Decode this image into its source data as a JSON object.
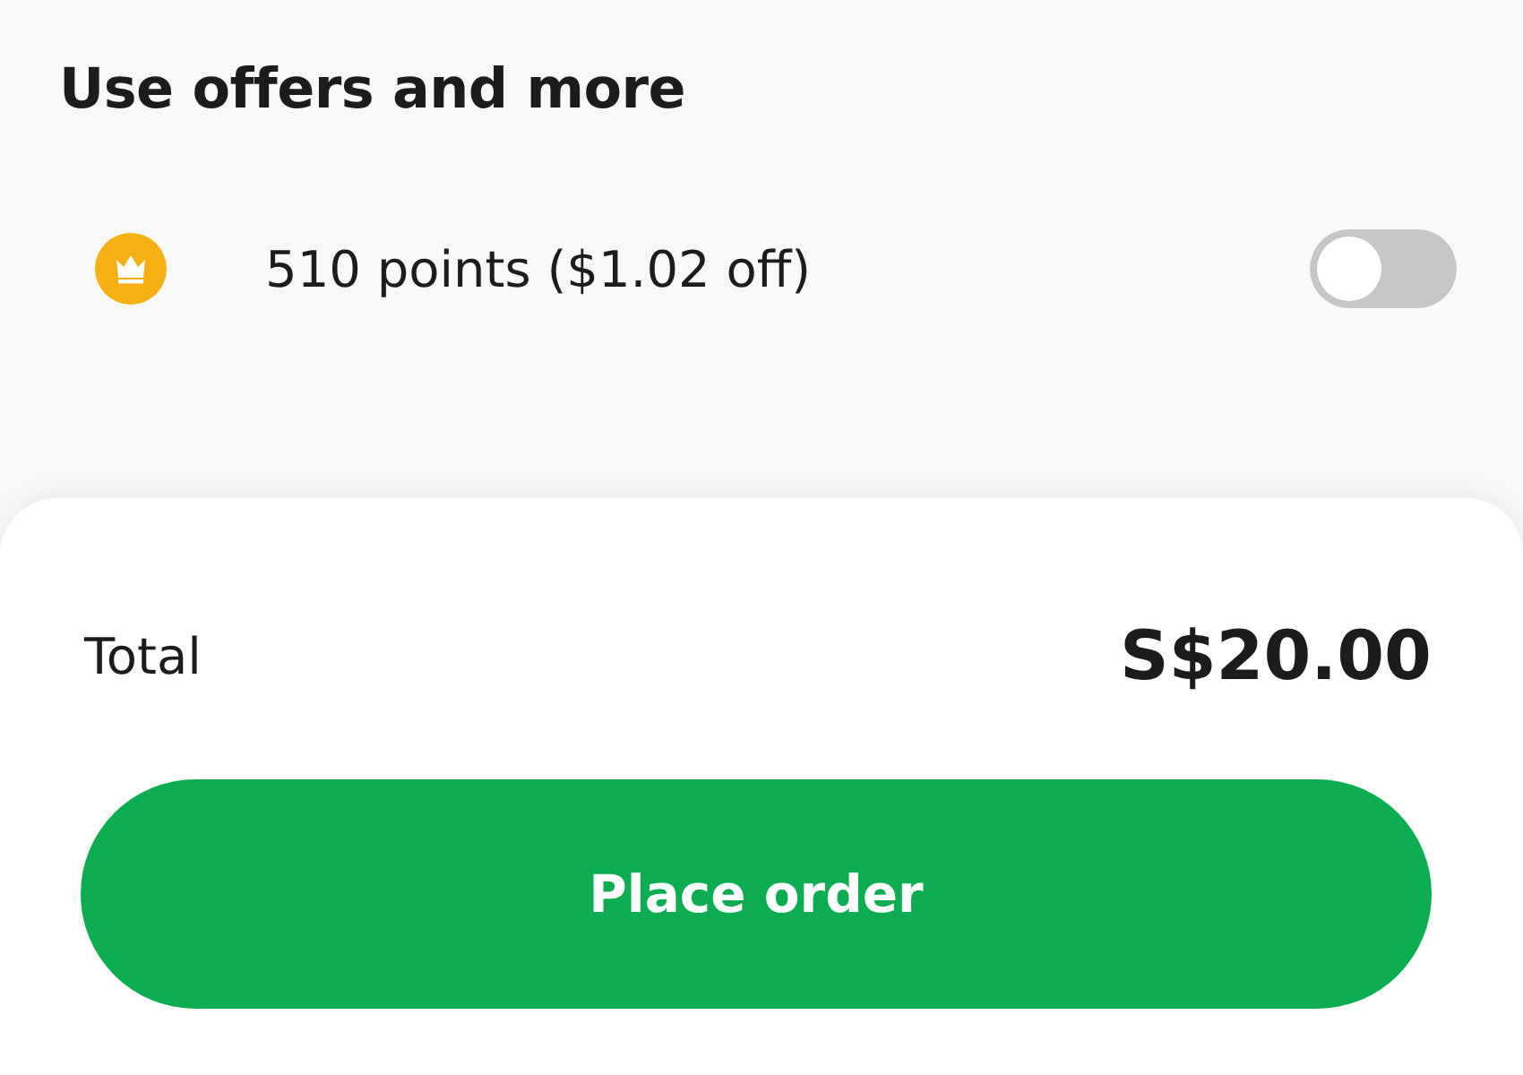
{
  "offers": {
    "title": "Use offers and more",
    "points_option": {
      "label": "510 points ($1.02 off)",
      "on": false
    }
  },
  "summary": {
    "total_label": "Total",
    "total_value": "S$20.00"
  },
  "primary_button": {
    "label": "Place order"
  }
}
